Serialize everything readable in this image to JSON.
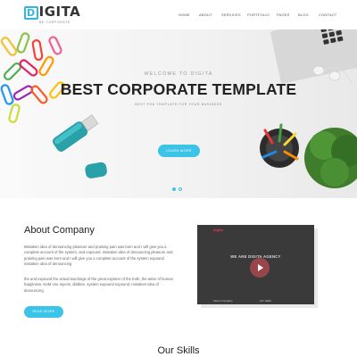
{
  "nav": {
    "logo_text": "IGITA",
    "logo_letter": "D",
    "logo_sub": "BE CORPORATE",
    "items": [
      "HOME",
      "ABOUT",
      "SERVICES",
      "PORTFOLIO",
      "PAGES",
      "BLOG",
      "CONTACT"
    ]
  },
  "hero": {
    "welcome": "WELCOME TO DIGITA",
    "title": "BEST CORPORATE TEMPLATE",
    "subtitle": "BEST PSD TEMPLATE FOR YOUR BUSINESS",
    "button": "LEARN MORE"
  },
  "about": {
    "title": "About Company",
    "para1": "Mistaken idea of denouncing pleasure and praising pain was born and I will give you a complete account of the system, and expound. mistaken idea of denouncing pleasure and praising pain was born and I will give you a complete account of the system expound mistaken idea of denouncing",
    "para2": "the and expound the actual teachings of the great explorer of the truth, the-aster of human happiness. NoM one rejects, dislikes. system expound expound, mistaken idea of denouncing",
    "button": "READ MORE"
  },
  "video": {
    "brand": "digita",
    "heading": "WE ARE DIGITA AGENCY",
    "label_left": "About Company",
    "label_right": "Our Skills"
  },
  "skills": {
    "title": "Our Skills"
  },
  "colors": {
    "accent": "#3cc3e8"
  }
}
